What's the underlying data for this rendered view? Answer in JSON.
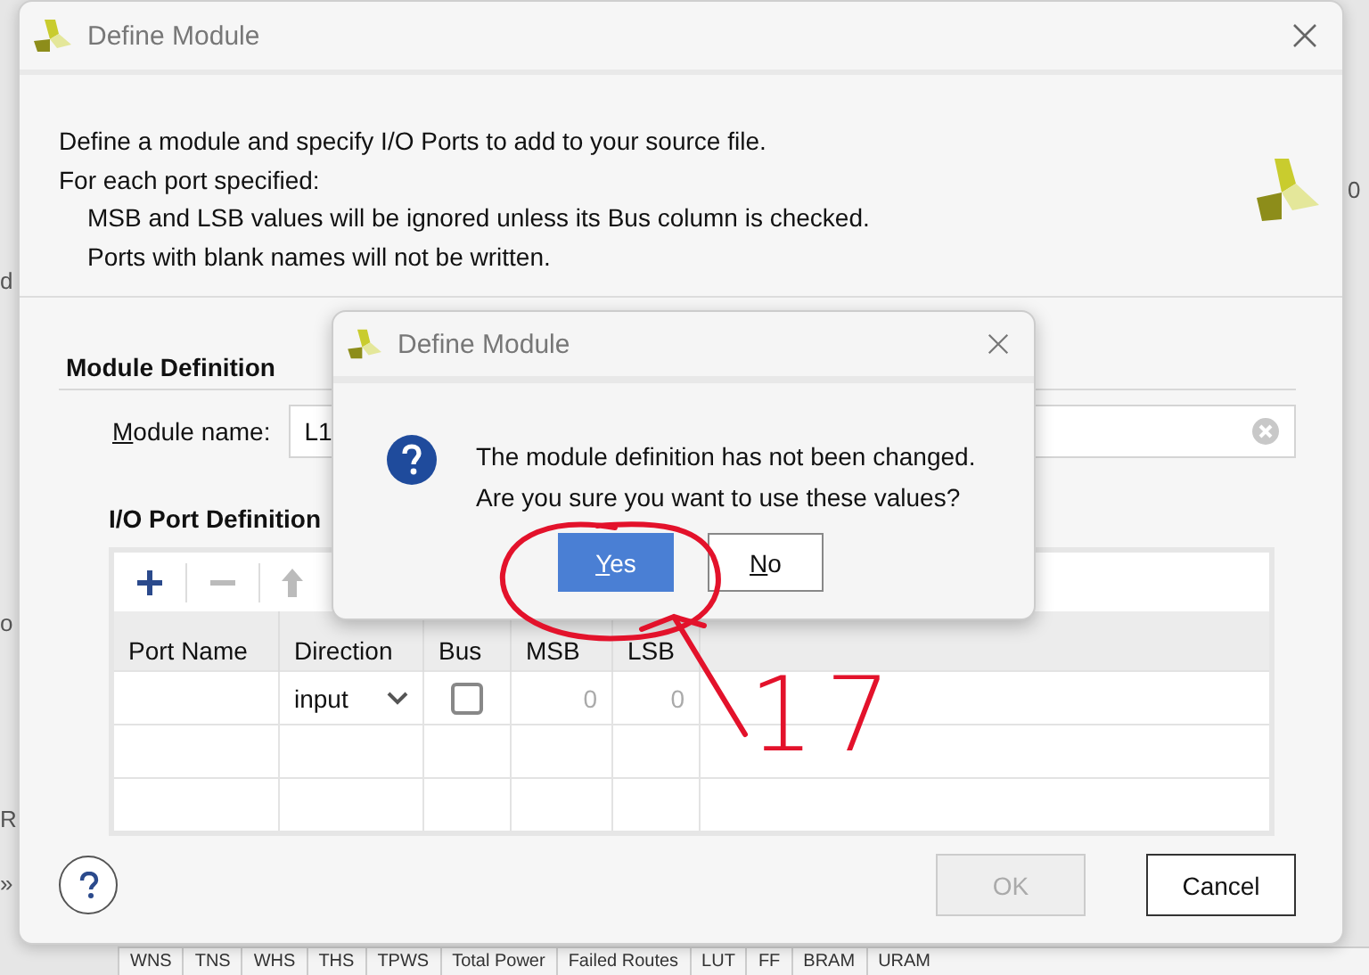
{
  "background": {
    "edge_texts": [
      "d",
      "o",
      "R",
      "»",
      "0"
    ],
    "bottom_columns": [
      "WNS",
      "TNS",
      "WHS",
      "THS",
      "TPWS",
      "Total Power",
      "Failed Routes",
      "LUT",
      "FF",
      "BRAM",
      "URAM"
    ]
  },
  "dialog": {
    "title": "Define Module",
    "intro": [
      "Define a module and specify I/O Ports to add to your source file.",
      "For each port specified:"
    ],
    "notes": [
      "MSB and LSB values will be ignored unless its Bus column is checked.",
      "Ports with blank names will not be written."
    ],
    "section_title": "Module Definition",
    "module_name": {
      "label": "Module name:",
      "mnemonic": true,
      "value": "L1"
    },
    "ports_title": "I/O Port Definition",
    "toolbar": [
      {
        "kind": "add",
        "disabled": false
      },
      {
        "kind": "remove",
        "disabled": true
      },
      {
        "kind": "up",
        "disabled": true
      }
    ],
    "columns": [
      "Port Name",
      "Direction",
      "Bus",
      "MSB",
      "LSB"
    ],
    "rows": [
      {
        "kind": "port",
        "direction": "input",
        "bus": false,
        "msb": "0",
        "lsb": "0"
      },
      {
        "kind": "blank"
      },
      {
        "kind": "blank"
      }
    ],
    "buttons": [
      {
        "label": "OK",
        "disabled": true
      },
      {
        "label": "Cancel",
        "disabled": false
      }
    ]
  },
  "confirm": {
    "title": "Define Module",
    "message": [
      "The module definition has not been changed.",
      "Are you sure you want to use these values?"
    ],
    "buttons": [
      {
        "label": "Yes",
        "mnemonic": true,
        "selected": true
      },
      {
        "label": "No",
        "mnemonic": true,
        "selected": false
      }
    ]
  },
  "annotation": {
    "label": "17"
  }
}
